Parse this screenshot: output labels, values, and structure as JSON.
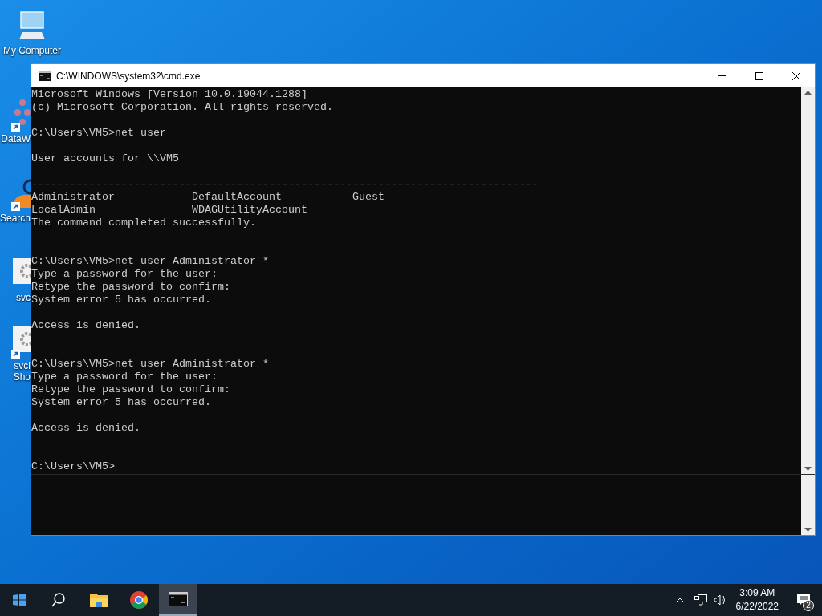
{
  "desktop_icons": [
    {
      "label": "My Computer",
      "kind": "computer",
      "shortcut": false
    },
    {
      "label": "DataW",
      "kind": "network",
      "shortcut": true
    },
    {
      "label": "Search",
      "kind": "search",
      "shortcut": true
    },
    {
      "label": "svc",
      "kind": "gear",
      "shortcut": false
    },
    {
      "label": "svcl\nSho",
      "kind": "gear",
      "shortcut": true
    }
  ],
  "window": {
    "title": "C:\\WINDOWS\\system32\\cmd.exe",
    "console_lines": [
      {
        "kind": "text",
        "text": "Microsoft Windows [Version 10.0.19044.1288]"
      },
      {
        "kind": "text",
        "text": "(c) Microsoft Corporation. All rights reserved."
      },
      {
        "kind": "blank"
      },
      {
        "kind": "text",
        "text": "C:\\Users\\VM5>net user"
      },
      {
        "kind": "blank"
      },
      {
        "kind": "text",
        "text": "User accounts for \\\\VM5"
      },
      {
        "kind": "blank"
      },
      {
        "kind": "text",
        "text": "-------------------------------------------------------------------------------"
      },
      {
        "kind": "text",
        "text": "Administrator            DefaultAccount           Guest"
      },
      {
        "kind": "text",
        "text": "LocalAdmin               WDAGUtilityAccount"
      },
      {
        "kind": "text",
        "text": "The command completed successfully."
      },
      {
        "kind": "blank"
      },
      {
        "kind": "blank"
      },
      {
        "kind": "text",
        "text": "C:\\Users\\VM5>net user Administrator *"
      },
      {
        "kind": "text",
        "text": "Type a password for the user:"
      },
      {
        "kind": "text",
        "text": "Retype the password to confirm:"
      },
      {
        "kind": "text",
        "text": "System error 5 has occurred."
      },
      {
        "kind": "blank"
      },
      {
        "kind": "text",
        "text": "Access is denied."
      },
      {
        "kind": "blank"
      },
      {
        "kind": "blank"
      },
      {
        "kind": "text",
        "text": "C:\\Users\\VM5>net user Administrator *"
      },
      {
        "kind": "text",
        "text": "Type a password for the user:"
      },
      {
        "kind": "text",
        "text": "Retype the password to confirm:"
      },
      {
        "kind": "text",
        "text": "System error 5 has occurred."
      },
      {
        "kind": "blank"
      },
      {
        "kind": "text",
        "text": "Access is denied."
      },
      {
        "kind": "blank"
      },
      {
        "kind": "blank"
      },
      {
        "kind": "text",
        "text": "C:\\Users\\VM5>"
      }
    ]
  },
  "taskbar": {
    "apps": [
      {
        "kind": "search",
        "selected": false
      },
      {
        "kind": "folder",
        "selected": false
      },
      {
        "kind": "browser",
        "selected": false
      },
      {
        "kind": "terminal",
        "selected": true
      }
    ],
    "time": "3:09 AM",
    "date": "6/22/2022",
    "notification_count": "2"
  }
}
